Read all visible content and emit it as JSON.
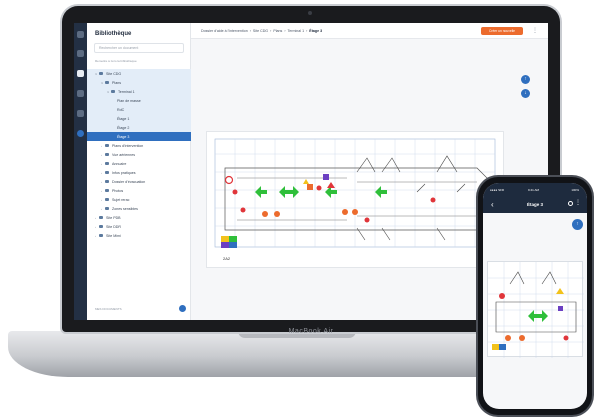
{
  "laptop": {
    "model_label": "MacBook Air"
  },
  "app": {
    "sidebar": {
      "title": "Bibliothèque",
      "search_placeholder": "Rechercher un document",
      "reset_label": "Remettre à zéro la bibliothèque",
      "footer_label": "MES DOCUMENTS",
      "tree": [
        {
          "label": "Site CDG",
          "indent": 0,
          "caret": "∨",
          "type": "folder",
          "state": "hl"
        },
        {
          "label": "Plans",
          "indent": 1,
          "caret": "∨",
          "type": "folder",
          "state": "hl"
        },
        {
          "label": "Terminal 1",
          "indent": 2,
          "caret": "∨",
          "type": "folder",
          "state": "hl"
        },
        {
          "label": "Plan de masse",
          "indent": 3,
          "caret": "",
          "type": "plan",
          "state": "hl"
        },
        {
          "label": "RdC",
          "indent": 3,
          "caret": "",
          "type": "plan",
          "state": "hl"
        },
        {
          "label": "Étage 1",
          "indent": 3,
          "caret": "",
          "type": "plan",
          "state": "hl"
        },
        {
          "label": "Étage 2",
          "indent": 3,
          "caret": "",
          "type": "plan",
          "state": "hl"
        },
        {
          "label": "Étage 3",
          "indent": 3,
          "caret": "",
          "type": "plan",
          "state": "sel"
        },
        {
          "label": "Plans d'intervention",
          "indent": 1,
          "caret": "›",
          "type": "folder",
          "state": ""
        },
        {
          "label": "Vue aériennes",
          "indent": 1,
          "caret": "›",
          "type": "folder",
          "state": ""
        },
        {
          "label": "Annuaire",
          "indent": 1,
          "caret": "›",
          "type": "folder",
          "state": ""
        },
        {
          "label": "Infos pratiques",
          "indent": 1,
          "caret": "›",
          "type": "folder",
          "state": ""
        },
        {
          "label": "Dossier d'évacuation",
          "indent": 1,
          "caret": "›",
          "type": "folder",
          "state": ""
        },
        {
          "label": "Photos",
          "indent": 1,
          "caret": "›",
          "type": "folder",
          "state": ""
        },
        {
          "label": "Sujet rerac",
          "indent": 1,
          "caret": "›",
          "type": "folder",
          "state": ""
        },
        {
          "label": "Zones sensibles",
          "indent": 1,
          "caret": "›",
          "type": "folder",
          "state": ""
        },
        {
          "label": "Site PDB",
          "indent": 0,
          "caret": "›",
          "type": "folder",
          "state": ""
        },
        {
          "label": "Site DDR",
          "indent": 0,
          "caret": "›",
          "type": "folder",
          "state": ""
        },
        {
          "label": "Site Mimi",
          "indent": 0,
          "caret": "›",
          "type": "folder",
          "state": ""
        }
      ]
    },
    "breadcrumb": [
      "Dossier d'aide à l'intervention",
      "Site CDG",
      "Plans",
      "Terminal 1",
      "Étage 3"
    ],
    "breadcrumb_sep": "›",
    "new_button_label": "Créer un nouvelle",
    "fab_up": "↑",
    "fab_down": "↓",
    "plan_caption": "2A2"
  },
  "phone": {
    "status_left": "●●●● SFR",
    "status_time": "9:41 AM",
    "status_right": "100%",
    "title": "Étage 3",
    "back": "‹",
    "more": "⋮",
    "fab": "↑"
  },
  "colors": {
    "rail": "#233044",
    "selected": "#2f6fbf",
    "orange": "#ec6b2d",
    "plan_green": "#2fbf3a",
    "plan_red": "#e0353a",
    "plan_yellow": "#f2c21b",
    "plan_purple": "#6b3fc2"
  }
}
